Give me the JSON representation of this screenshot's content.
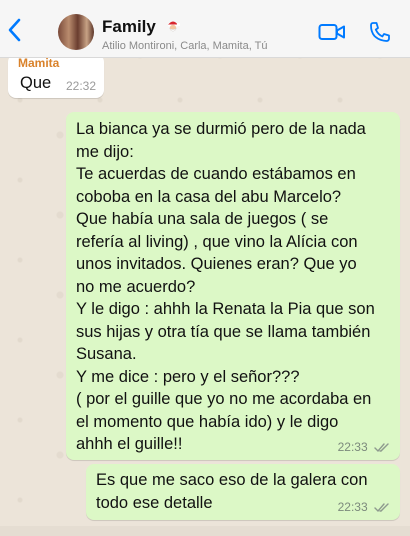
{
  "header": {
    "back_icon": "chevron-left-icon",
    "title": "Family",
    "title_emoji": "santa-emoji-icon",
    "subtitle": "Atilio Montironi, Carla, Mamita, Tú",
    "video_icon": "video-call-icon",
    "phone_icon": "phone-call-icon",
    "accent": "#007aff"
  },
  "messages": [
    {
      "direction": "incoming",
      "sender": "Mamita",
      "text": "Que",
      "time": "22:32"
    },
    {
      "direction": "outgoing",
      "text": "La bianca ya se durmió pero de la nada\nme dijo:\nTe acuerdas de cuando estábamos en\ncoboba en la casa del abu Marcelo?\nQue había una sala de juegos ( se\nrefería al living) , que vino la Alícia con\nunos invitados. Quienes eran? Que yo\nno me acuerdo?\nY le digo : ahhh la Renata la Pia que son\nsus hijas y otra tía que se llama también\nSusana.\nY me dice : pero y el señor???\n( por el guille que yo no me acordaba en\nel momento que había ido) y le digo\nahhh el guille!!",
      "time": "22:33",
      "status": "read-ticks-icon"
    },
    {
      "direction": "outgoing",
      "text": "Es que me saco eso de la galera con\ntodo ese detalle",
      "time": "22:33",
      "status": "read-ticks-icon"
    }
  ],
  "colors": {
    "incoming_bubble": "#ffffff",
    "outgoing_bubble": "#dcf8c6",
    "sender_name": "#d9822b"
  }
}
